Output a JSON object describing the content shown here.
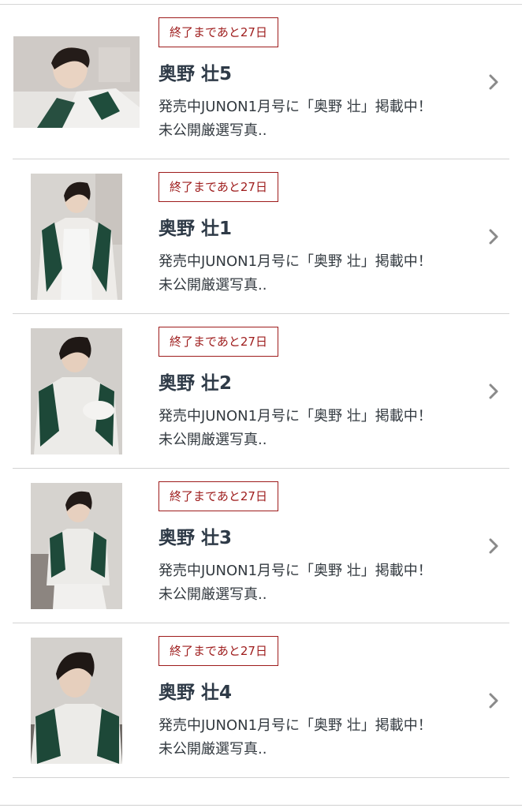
{
  "items": [
    {
      "badge": "終了まであと27日",
      "title": "奥野 壮5",
      "desc_line1": "発売中JUNON1月号に「奥野 壮」掲載中！",
      "desc_line2": "未公開厳選写真.."
    },
    {
      "badge": "終了まであと27日",
      "title": "奥野 壮1",
      "desc_line1": "発売中JUNON1月号に「奥野 壮」掲載中！",
      "desc_line2": "未公開厳選写真.."
    },
    {
      "badge": "終了まであと27日",
      "title": "奥野 壮2",
      "desc_line1": "発売中JUNON1月号に「奥野 壮」掲載中！",
      "desc_line2": "未公開厳選写真.."
    },
    {
      "badge": "終了まであと27日",
      "title": "奥野 壮3",
      "desc_line1": "発売中JUNON1月号に「奥野 壮」掲載中！",
      "desc_line2": "未公開厳選写真.."
    },
    {
      "badge": "終了まであと27日",
      "title": "奥野 壮4",
      "desc_line1": "発売中JUNON1月号に「奥野 壮」掲載中！",
      "desc_line2": "未公開厳選写真.."
    }
  ],
  "colors": {
    "badge_border": "#9e1c1c",
    "title": "#2e3a47",
    "chevron": "#8a8a8a",
    "divider": "#d3d3d3"
  },
  "icons": {
    "row_arrow": "chevron-right-icon"
  }
}
